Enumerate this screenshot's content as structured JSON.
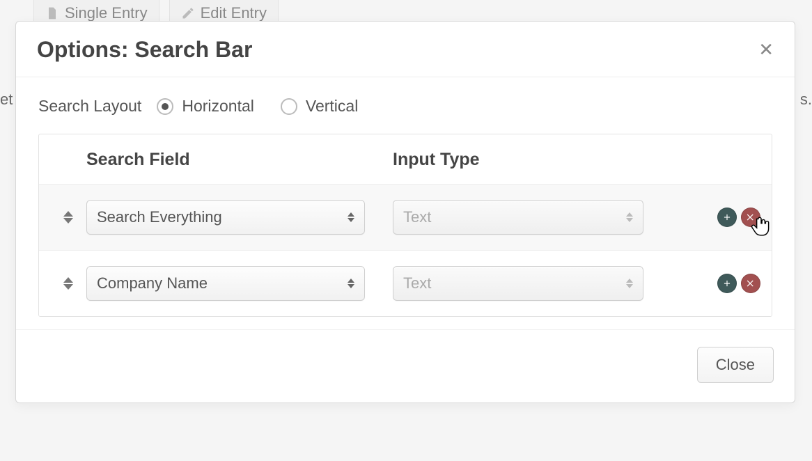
{
  "background": {
    "tabs": [
      {
        "label": "Single Entry"
      },
      {
        "label": "Edit Entry"
      }
    ],
    "left_fragment": "et",
    "right_fragment": "s."
  },
  "modal": {
    "title": "Options: Search Bar",
    "layout": {
      "label": "Search Layout",
      "options": [
        {
          "label": "Horizontal",
          "selected": true
        },
        {
          "label": "Vertical",
          "selected": false
        }
      ]
    },
    "table": {
      "headers": {
        "field": "Search Field",
        "type": "Input Type"
      },
      "rows": [
        {
          "field": "Search Everything",
          "type": "Text",
          "type_disabled": true,
          "cursor_on_delete": true
        },
        {
          "field": "Company Name",
          "type": "Text",
          "type_disabled": true,
          "cursor_on_delete": false
        }
      ]
    },
    "footer": {
      "close": "Close"
    }
  }
}
